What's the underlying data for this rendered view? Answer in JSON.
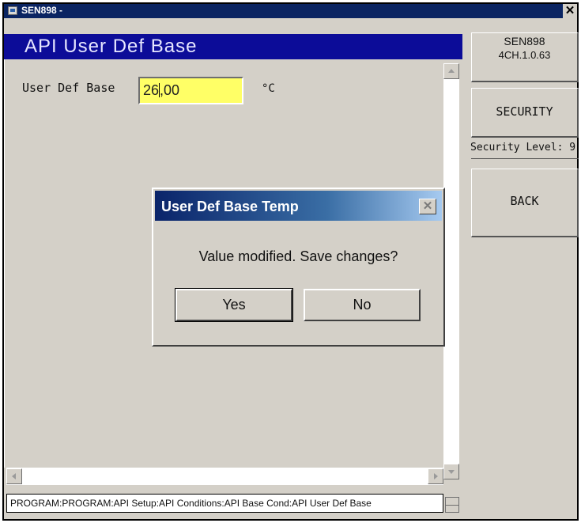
{
  "window": {
    "title": "SEN898 -",
    "close_glyph": "✕"
  },
  "screen": {
    "title": "API User Def Base"
  },
  "field": {
    "label": "User Def Base",
    "value_before_caret": "26",
    "value_after_caret": ",00",
    "unit": "°C"
  },
  "side": {
    "model": "SEN898",
    "version": "4CH.1.0.63",
    "security_button": "SECURITY",
    "security_level": "Security Level: 9",
    "back_button": "BACK"
  },
  "status": {
    "path": "PROGRAM:PROGRAM:API Setup:API Conditions:API Base Cond:API User Def Base"
  },
  "dialog": {
    "title": "User Def Base Temp",
    "message": "Value modified. Save changes?",
    "yes": "Yes",
    "no": "No",
    "close_glyph": "✕"
  },
  "colors": {
    "title_bar": "#0a2462",
    "header": "#0c0c98",
    "input_bg": "#ffff66",
    "face": "#d4d0c8"
  },
  "icons": {
    "window": "app-window-icon",
    "scroll_up": "arrow-up-icon",
    "scroll_down": "arrow-down-icon",
    "scroll_left": "arrow-left-icon",
    "scroll_right": "arrow-right-icon"
  }
}
